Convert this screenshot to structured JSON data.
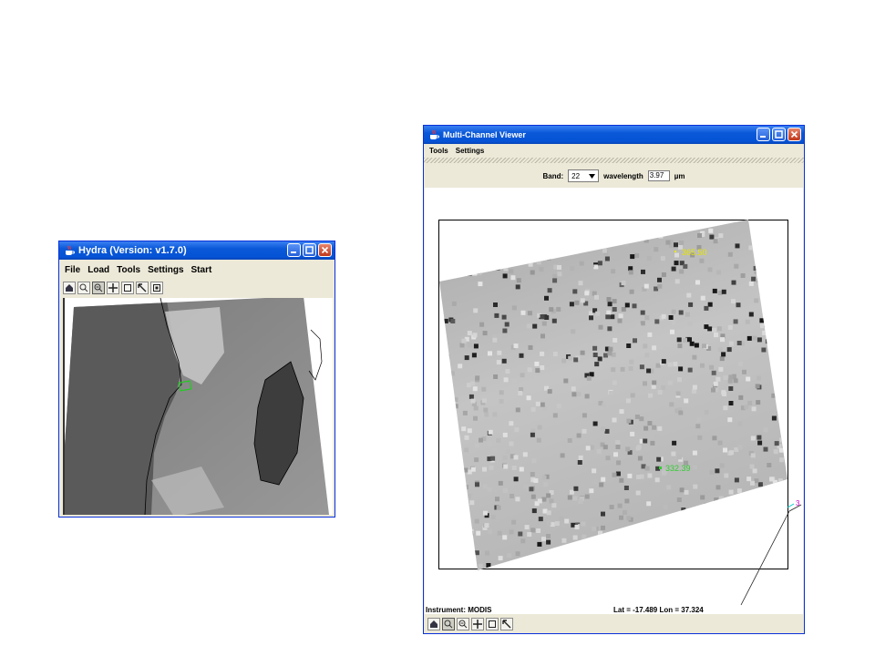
{
  "hydra": {
    "title": "Hydra  (Version: v1.7.0)",
    "menu": [
      "File",
      "Load",
      "Tools",
      "Settings",
      "Start"
    ],
    "toolbar": [
      "home-tool",
      "zoom-in-tool",
      "zoom-out-tool",
      "pan-tool",
      "select-box-tool",
      "pointer-tool",
      "probe-tool"
    ]
  },
  "viewer": {
    "title": "Multi-Channel Viewer",
    "menu": [
      "Tools",
      "Settings"
    ],
    "band_label": "Band:",
    "band_value": "22",
    "wavelength_label": "wavelength",
    "wavelength_value": "3.97",
    "unit": "µm",
    "probe_yellow": "365.50",
    "probe_green": "332.39",
    "probe_magenta": "3",
    "instrument": "Instrument: MODIS",
    "latlon": "Lat = -17.489  Lon = 37.324",
    "toolbar": [
      "home-tool",
      "zoom-in-tool",
      "zoom-out-tool",
      "pan-tool",
      "select-box-tool",
      "pointer-tool"
    ]
  },
  "colors": {
    "title_bar": "#0a59d8",
    "window_bg": "#ece9d8",
    "probe_yellow": "#e6e600",
    "probe_green": "#33cc33",
    "probe_magenta": "#cc00cc",
    "probe_cyan": "#00cccc"
  }
}
